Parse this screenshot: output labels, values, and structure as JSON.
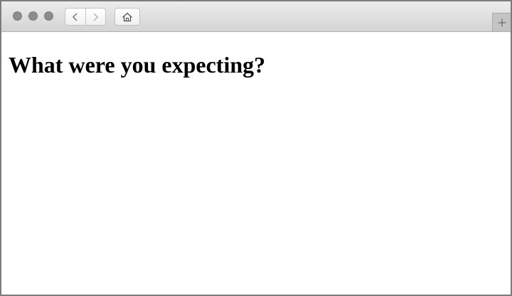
{
  "browser": {
    "nav": {
      "back_icon": "chevron-left-icon",
      "forward_icon": "chevron-right-icon",
      "home_icon": "home-icon"
    },
    "new_tab_icon": "plus-icon",
    "traffic_light_color": "#8c8c8c"
  },
  "page": {
    "heading": "What were you expecting?"
  }
}
